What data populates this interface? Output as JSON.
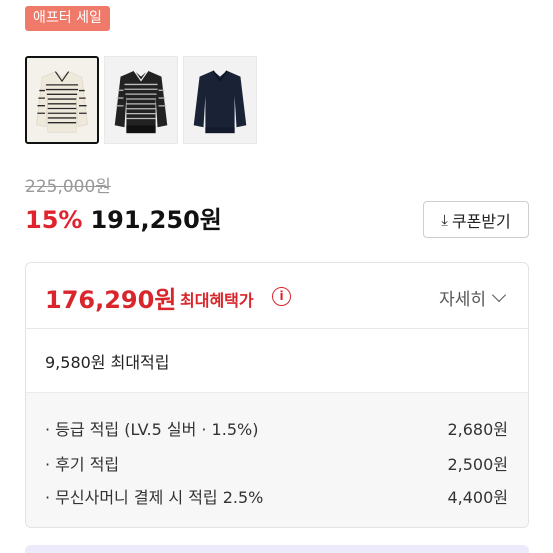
{
  "badge": {
    "label": "애프터 세일"
  },
  "thumbnails": [
    {
      "name": "cream-striped-sweater",
      "selected": true
    },
    {
      "name": "gray-striped-sweater",
      "selected": false
    },
    {
      "name": "navy-sweater",
      "selected": false
    }
  ],
  "pricing": {
    "original_price": "225,000원",
    "discount_rate": "15%",
    "sale_price": "191,250원"
  },
  "coupon_button": {
    "label": "쿠폰받기",
    "icon": "download-icon"
  },
  "benefit": {
    "max_price": "176,290원",
    "max_price_label": "최대혜택가",
    "info_icon": "i",
    "detail_toggle_label": "자세히",
    "max_points": "9,580원 최대적립",
    "points": [
      {
        "label": "· 등급 적립 (LV.5 실버 · 1.5%)",
        "value": "2,680원"
      },
      {
        "label": "· 후기 적립",
        "value": "2,500원"
      },
      {
        "label": "· 무신사머니 결제 시 적립 2.5%",
        "value": "4,400원"
      }
    ]
  },
  "colors": {
    "badge_bg": "#f07a6a",
    "discount_red": "#e0242f",
    "benefit_red": "#d8262c"
  }
}
